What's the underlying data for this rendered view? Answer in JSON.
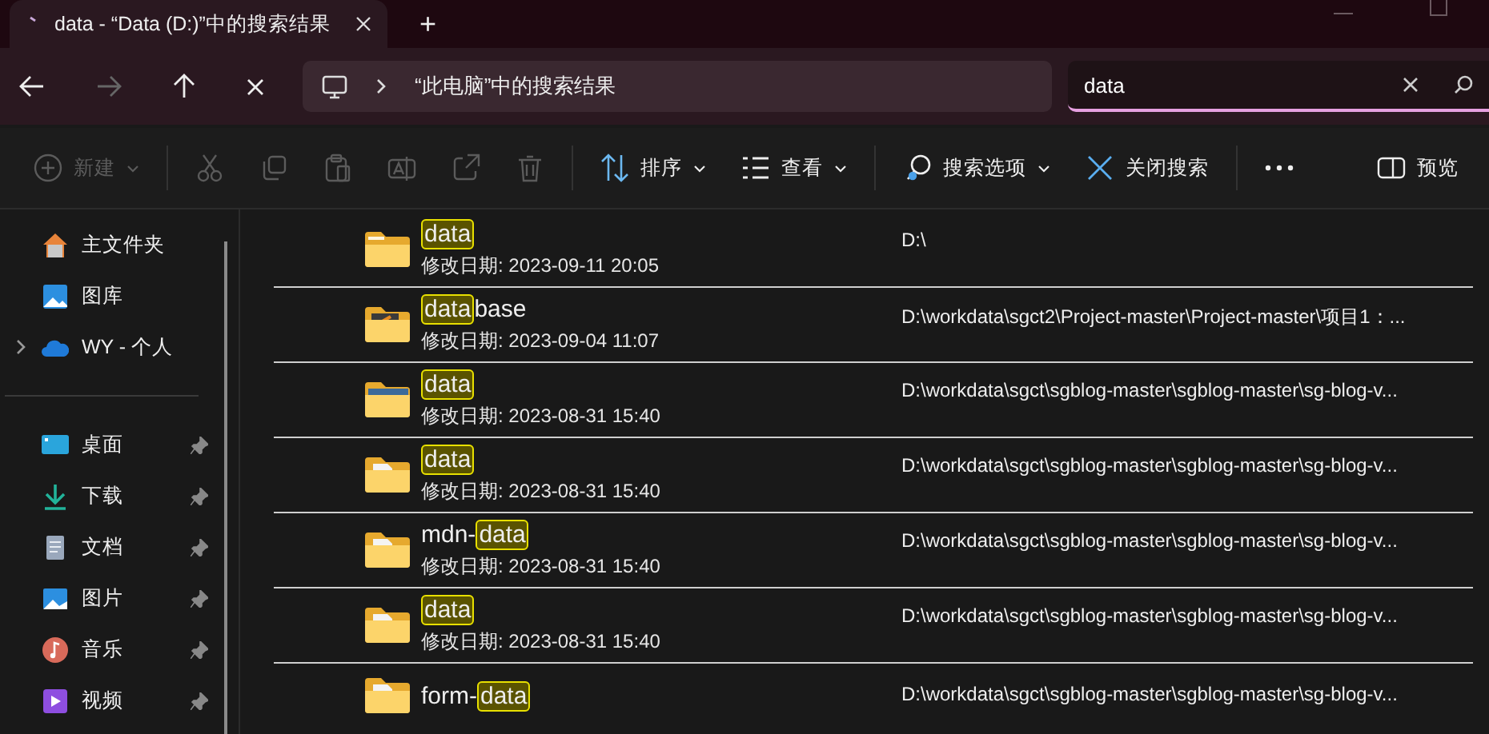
{
  "window": {
    "tab_title": "data - “Data (D:)”中的搜索结果",
    "new_tab": "+"
  },
  "nav": {
    "back_disabled": false,
    "forward_disabled": true,
    "address": "“此电脑”中的搜索结果",
    "search": {
      "value": "data"
    }
  },
  "toolbar": [
    {
      "kind": "text",
      "label": "新建",
      "caret": true,
      "disabled": true
    },
    {
      "kind": "sep"
    },
    {
      "kind": "icon",
      "disabled": true
    },
    {
      "kind": "icon",
      "disabled": true
    },
    {
      "kind": "icon",
      "disabled": true
    },
    {
      "kind": "icon",
      "disabled": true
    },
    {
      "kind": "icon",
      "disabled": true
    },
    {
      "kind": "icon",
      "disabled": true
    },
    {
      "kind": "sep"
    },
    {
      "kind": "text",
      "label": "排序",
      "caret": true,
      "disabled": false
    },
    {
      "kind": "text",
      "label": "查看",
      "caret": true,
      "disabled": false
    },
    {
      "kind": "sep"
    },
    {
      "kind": "text",
      "label": "搜索选项",
      "caret": true,
      "disabled": false
    },
    {
      "kind": "text",
      "label": "关闭搜索",
      "caret": false,
      "disabled": false
    },
    {
      "kind": "sep"
    },
    {
      "kind": "icon",
      "disabled": false
    },
    {
      "kind": "spacer"
    },
    {
      "kind": "text",
      "label": "预览",
      "caret": false,
      "disabled": false
    }
  ],
  "sidebar": {
    "groups": [
      [
        {
          "label": "主文件夹",
          "expandable": false,
          "pinned": false
        },
        {
          "label": "图库",
          "expandable": false,
          "pinned": false
        },
        {
          "label": "WY - 个人",
          "expandable": true,
          "pinned": false
        }
      ],
      [
        {
          "label": "桌面",
          "expandable": false,
          "pinned": true
        },
        {
          "label": "下载",
          "expandable": false,
          "pinned": true
        },
        {
          "label": "文档",
          "expandable": false,
          "pinned": true
        },
        {
          "label": "图片",
          "expandable": false,
          "pinned": true
        },
        {
          "label": "音乐",
          "expandable": false,
          "pinned": true
        },
        {
          "label": "视频",
          "expandable": false,
          "pinned": true
        }
      ]
    ]
  },
  "results": [
    {
      "name": [
        {
          "text": "data",
          "match": true
        }
      ],
      "modified": "修改日期: 2023-09-11 20:05",
      "path": "D:\\"
    },
    {
      "name": [
        {
          "text": "data",
          "match": true
        },
        {
          "text": "base",
          "match": false
        }
      ],
      "modified": "修改日期: 2023-09-04 11:07",
      "path": "D:\\workdata\\sgct2\\Project-master\\Project-master\\项目1：..."
    },
    {
      "name": [
        {
          "text": "data",
          "match": true
        }
      ],
      "modified": "修改日期: 2023-08-31 15:40",
      "path": "D:\\workdata\\sgct\\sgblog-master\\sgblog-master\\sg-blog-v..."
    },
    {
      "name": [
        {
          "text": "data",
          "match": true
        }
      ],
      "modified": "修改日期: 2023-08-31 15:40",
      "path": "D:\\workdata\\sgct\\sgblog-master\\sgblog-master\\sg-blog-v..."
    },
    {
      "name": [
        {
          "text": "mdn-",
          "match": false
        },
        {
          "text": "data",
          "match": true
        }
      ],
      "modified": "修改日期: 2023-08-31 15:40",
      "path": "D:\\workdata\\sgct\\sgblog-master\\sgblog-master\\sg-blog-v..."
    },
    {
      "name": [
        {
          "text": "data",
          "match": true
        }
      ],
      "modified": "修改日期: 2023-08-31 15:40",
      "path": "D:\\workdata\\sgct\\sgblog-master\\sgblog-master\\sg-blog-v..."
    },
    {
      "name": [
        {
          "text": "form-",
          "match": false
        },
        {
          "text": "data",
          "match": true
        }
      ],
      "path": "D:\\workdata\\sgct\\sgblog-master\\sgblog-master\\sg-blog-v..."
    }
  ]
}
